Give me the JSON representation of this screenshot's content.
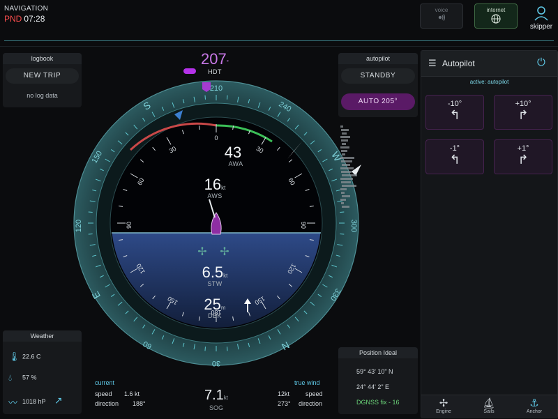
{
  "header": {
    "title": "NAVIGATION",
    "time_prefix": "PND",
    "time": "07:28",
    "voice_label": "voice",
    "internet_label": "internet",
    "skipper_label": "skipper"
  },
  "logbook": {
    "title": "logbook",
    "new_trip": "NEW TRIP",
    "empty": "no log data"
  },
  "autopilot_small": {
    "title": "autopilot",
    "standby": "STANDBY",
    "auto": "AUTO 205°"
  },
  "weather": {
    "title": "Weather",
    "temperature": "22.6 C",
    "humidity": "57 %",
    "pressure": "1018 hP"
  },
  "position": {
    "title": "Position Ideal",
    "lat": "59° 43' 10\" N",
    "lon": "24° 44' 2\" E",
    "status": "DGNSS fix - 16"
  },
  "autopilot_panel": {
    "title": "Autopilot",
    "active": "active: autopilot",
    "buttons": [
      {
        "label": "-10°",
        "arrow": "↰"
      },
      {
        "label": "+10°",
        "arrow": "↱"
      },
      {
        "label": "-1°",
        "arrow": "↰"
      },
      {
        "label": "+1°",
        "arrow": "↱"
      }
    ],
    "footer": [
      {
        "label": "Engine",
        "icon": "fan-icon"
      },
      {
        "label": "Sails",
        "icon": "sails-icon"
      },
      {
        "label": "Anchor",
        "icon": "anchor-icon"
      }
    ]
  },
  "gauge": {
    "heading_value": "207",
    "heading_deg_mark": "°",
    "heading_label": "HDT",
    "awa_value": "43",
    "awa_label": "AWA",
    "aws_value": "16",
    "aws_unit": "kt",
    "aws_label": "AWS",
    "stw_value": "6.5",
    "stw_unit": "kt",
    "stw_label": "STW",
    "dbk_value": "25",
    "dbk_unit": "m",
    "dbk_label": "DBK",
    "compass_labels": [
      "210",
      "240",
      "W",
      "300",
      "330",
      "N",
      "30",
      "60",
      "E",
      "120",
      "150",
      "S"
    ],
    "inner_labels": [
      "0",
      "30",
      "60",
      "90",
      "120",
      "150",
      "180",
      "150",
      "120",
      "90",
      "60",
      "30"
    ]
  },
  "current": {
    "title": "current",
    "speed_label": "speed",
    "speed_value": "1.6 kt",
    "direction_label": "direction",
    "direction_value": "188°"
  },
  "true_wind": {
    "title": "true wind",
    "speed_value": "12kt",
    "speed_label": "speed",
    "direction_value": "273°",
    "direction_label": "direction"
  },
  "sog": {
    "value": "7.1",
    "unit": "kt",
    "label": "SOG"
  }
}
